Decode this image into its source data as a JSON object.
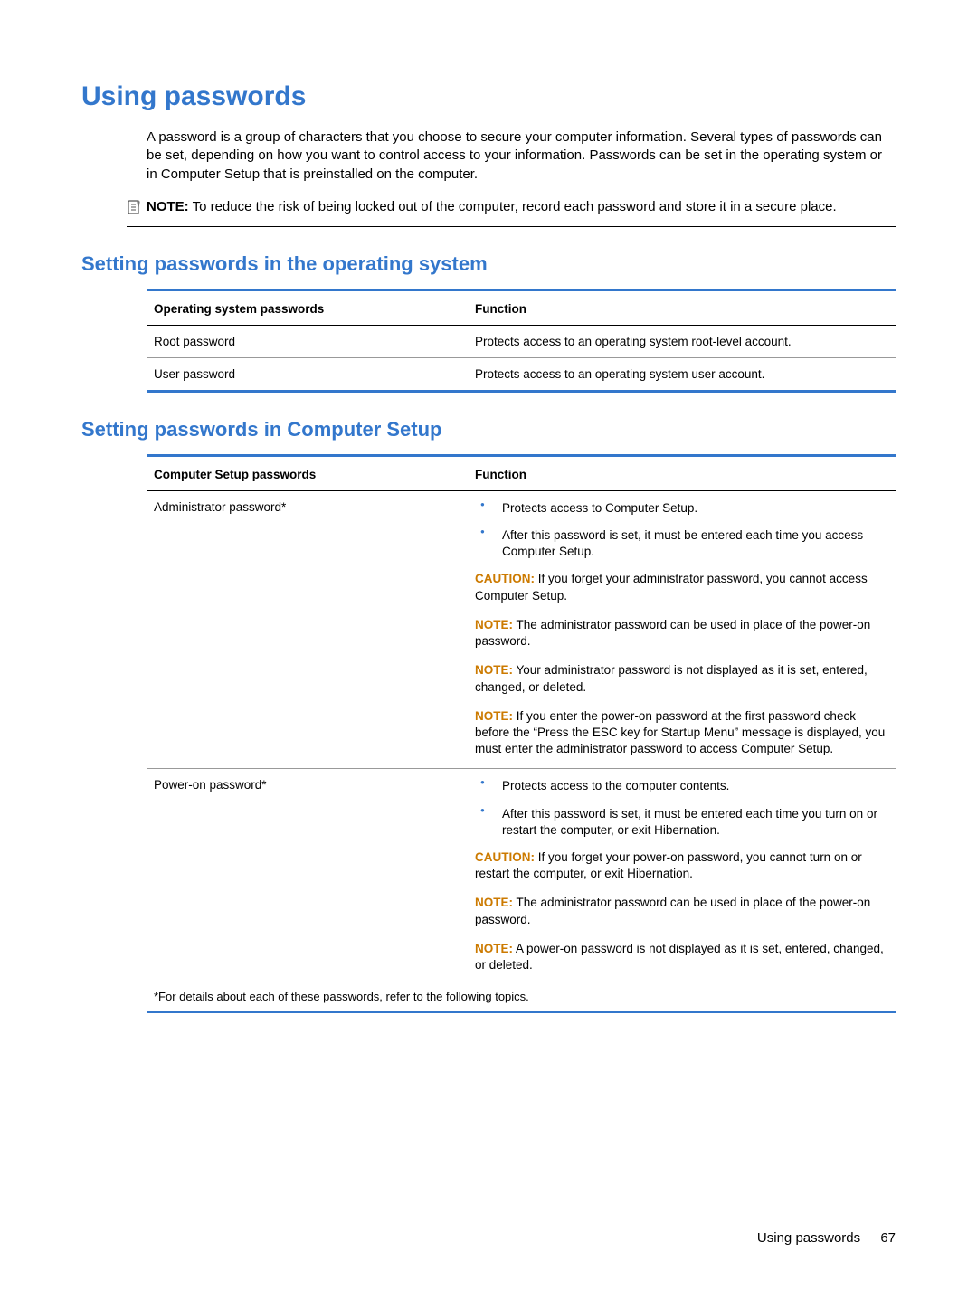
{
  "h1": "Using passwords",
  "intro": "A password is a group of characters that you choose to secure your computer information. Several types of passwords can be set, depending on how you want to control access to your information. Passwords can be set in the operating system or in Computer Setup that is preinstalled on the computer.",
  "top_note": {
    "label": "NOTE:",
    "text": "To reduce the risk of being locked out of the computer, record each password and store it in a secure place."
  },
  "section_os": {
    "heading": "Setting passwords in the operating system",
    "header_left": "Operating system passwords",
    "header_right": "Function",
    "rows": [
      {
        "name": "Root password",
        "desc": "Protects access to an operating system root-level account."
      },
      {
        "name": "User password",
        "desc": "Protects access to an operating system user account."
      }
    ]
  },
  "section_cs": {
    "heading": "Setting passwords in Computer Setup",
    "header_left": "Computer Setup passwords",
    "header_right": "Function",
    "admin": {
      "name": "Administrator password*",
      "bullets": [
        "Protects access to Computer Setup.",
        "After this password is set, it must be entered each time you access Computer Setup."
      ],
      "caution": {
        "label": "CAUTION:",
        "text": "If you forget your administrator password, you cannot access Computer Setup."
      },
      "note1": {
        "label": "NOTE:",
        "text": "The administrator password can be used in place of the power-on password."
      },
      "note2": {
        "label": "NOTE:",
        "text": "Your administrator password is not displayed as it is set, entered, changed, or deleted."
      },
      "note3": {
        "label": "NOTE:",
        "text": "If you enter the power-on password at the first password check before the “Press the ESC key for Startup Menu” message is displayed, you must enter the administrator password to access Computer Setup."
      }
    },
    "poweron": {
      "name": "Power-on password*",
      "bullets": [
        "Protects access to the computer contents.",
        "After this password is set, it must be entered each time you turn on or restart the computer, or exit Hibernation."
      ],
      "caution": {
        "label": "CAUTION:",
        "text": "If you forget your power-on password, you cannot turn on or restart the computer, or exit Hibernation."
      },
      "note1": {
        "label": "NOTE:",
        "text": "The administrator password can be used in place of the power-on password."
      },
      "note2": {
        "label": "NOTE:",
        "text": "A power-on password is not displayed as it is set, entered, changed, or deleted."
      }
    },
    "footnote": "*For details about each of these passwords, refer to the following topics."
  },
  "footer": {
    "title": "Using passwords",
    "page": "67"
  }
}
